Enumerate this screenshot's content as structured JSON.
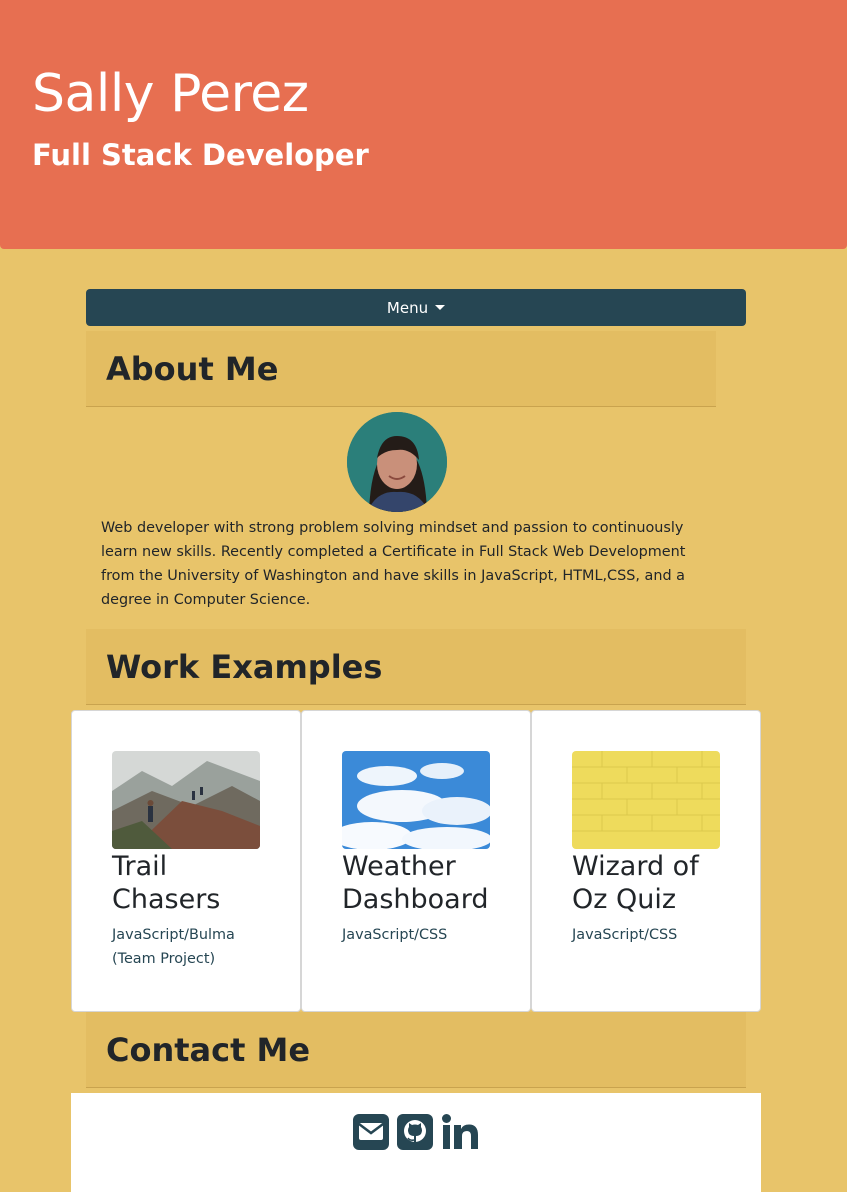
{
  "hero": {
    "name": "Sally Perez",
    "role": "Full Stack Developer"
  },
  "nav": {
    "menu_label": "Menu"
  },
  "about": {
    "heading": "About Me",
    "avatar_alt": "profile photo",
    "bio": "Web developer with strong problem solving mindset and passion to continuously learn new skills. Recently completed a Certificate in Full Stack Web Development from the University of Washington and have skills in JavaScript, HTML,CSS, and a degree in Computer Science."
  },
  "work": {
    "heading": "Work Examples",
    "projects": [
      {
        "title": "Trail Chasers",
        "tech": "JavaScript/Bulma (Team Project)",
        "image": "hikers-on-mountain"
      },
      {
        "title": "Weather Dashboard",
        "tech": "JavaScript/CSS",
        "image": "blue-sky-clouds"
      },
      {
        "title": "Wizard of Oz Quiz",
        "tech": "JavaScript/CSS",
        "image": "yellow-brick-wall"
      }
    ]
  },
  "contact": {
    "heading": "Contact Me",
    "icons": [
      "envelope-icon",
      "github-icon",
      "linkedin-icon"
    ]
  },
  "colors": {
    "page_bg": "#e8c46a",
    "hero_bg": "#e76f51",
    "navbar_bg": "#264653",
    "section_bg": "#e3bd62",
    "icon_color": "#264653"
  }
}
